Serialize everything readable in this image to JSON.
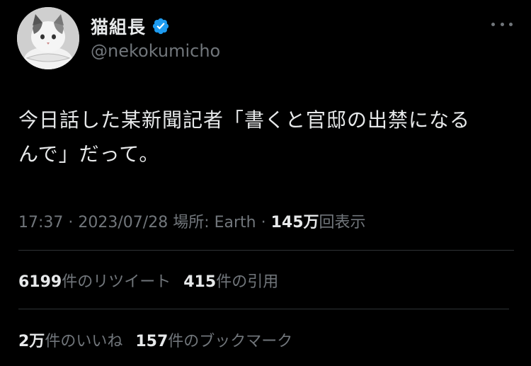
{
  "user": {
    "display_name": "猫組長",
    "handle": "@nekokumicho",
    "verified": true
  },
  "tweet": {
    "text_line1": "今日話した某新聞記者「書くと官邸の出禁になる",
    "text_line2": "んで」だって。"
  },
  "meta": {
    "time": "17:37",
    "separator1": " · ",
    "date": "2023/07/28",
    "location_label": " 場所: ",
    "location": "Earth",
    "separator2": " · ",
    "views_count": "145万",
    "views_label": "回表示"
  },
  "stats": {
    "retweets_count": "6199",
    "retweets_label": "件のリツイート",
    "quotes_count": "415",
    "quotes_label": "件の引用",
    "likes_count": "2万",
    "likes_label": "件のいいね",
    "bookmarks_count": "157",
    "bookmarks_label": "件のブックマーク"
  },
  "colors": {
    "background": "#000000",
    "primary_text": "#e7e9ea",
    "secondary_text": "#71767b",
    "divider": "#2f3336",
    "verified_blue": "#1d9bf0"
  },
  "icons": {
    "avatar": "cat-avatar",
    "verified": "verified-badge-icon",
    "more": "more-options-icon"
  }
}
